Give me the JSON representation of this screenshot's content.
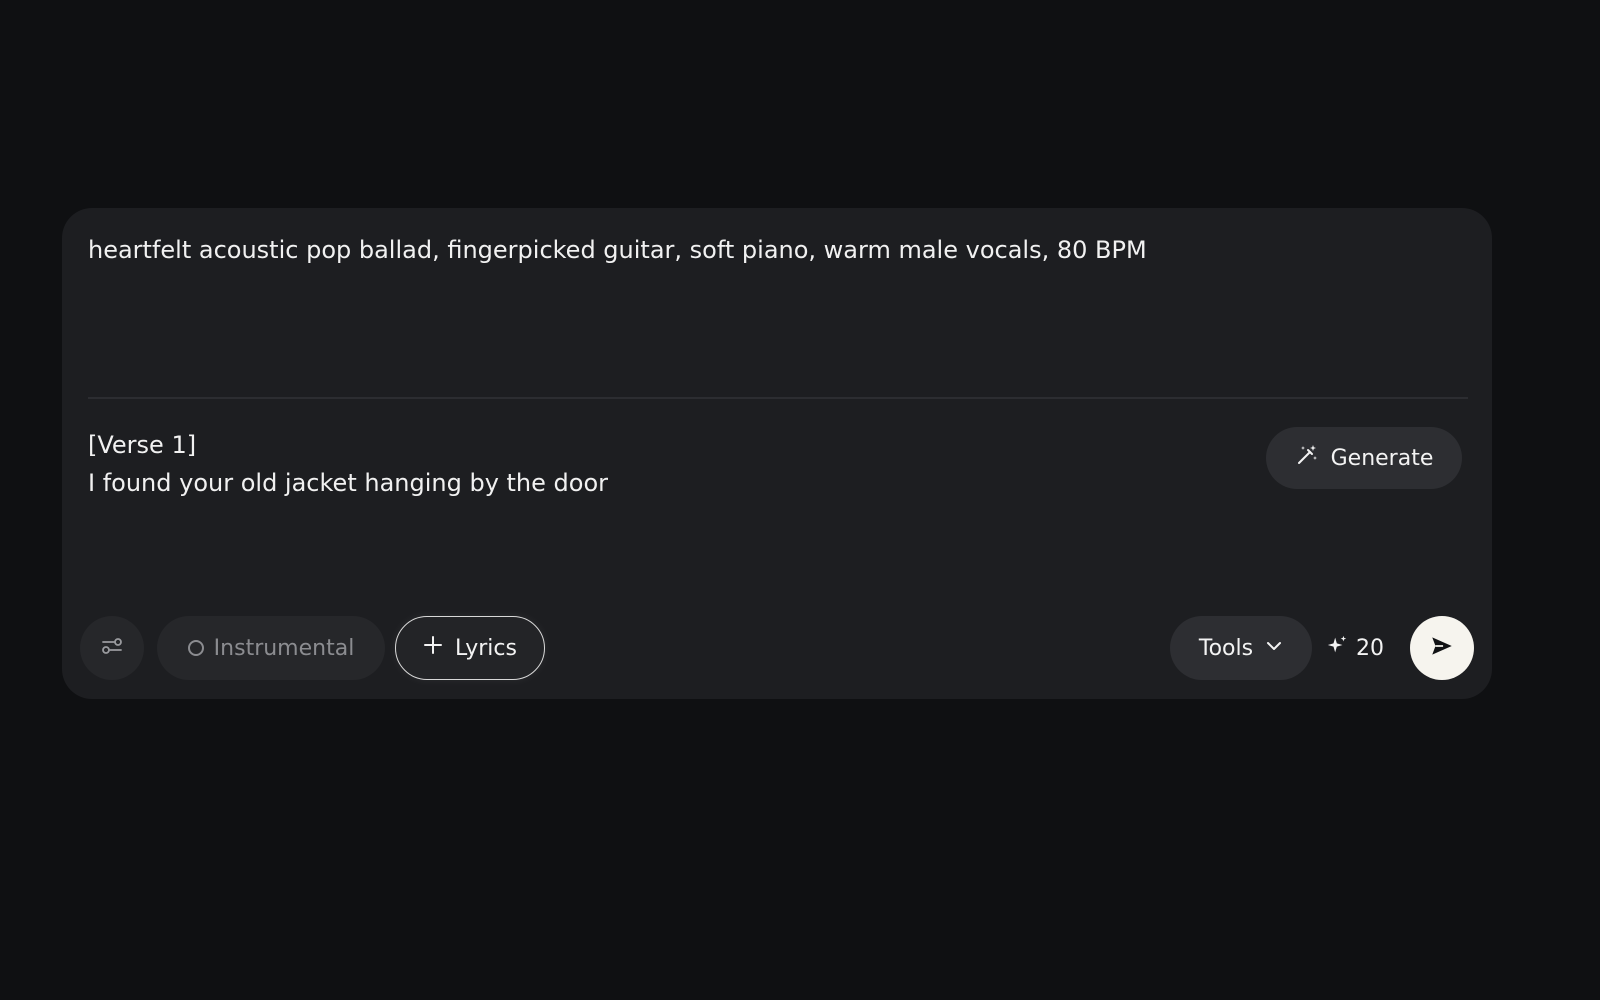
{
  "composer": {
    "prompt_text": "heartfelt acoustic pop ballad, fingerpicked guitar, soft piano, warm male vocals, 80 BPM",
    "lyrics_lines": [
      "[Verse 1]",
      "I found your old jacket hanging by the door"
    ],
    "generate_label": "Generate"
  },
  "toolbar": {
    "settings_icon": "sliders-icon",
    "instrumental_label": "Instrumental",
    "lyrics_label": "Lyrics",
    "tools_label": "Tools",
    "credits_count": "20",
    "send_icon": "send-icon"
  },
  "colors": {
    "background": "#0f1012",
    "panel": "#1d1e21",
    "send_button": "#f6f4ee"
  }
}
